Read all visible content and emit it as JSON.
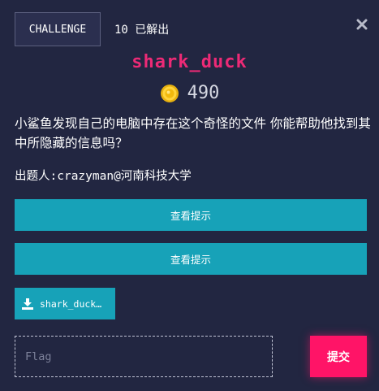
{
  "colors": {
    "background": "#222641",
    "challenge_name": "#ed2a76",
    "hint_button": "#17a2b8",
    "submit_button": "#ff1467"
  },
  "tabs": {
    "challenge": "CHALLENGE",
    "solves": "10 已解出"
  },
  "close_icon": "close-icon",
  "challenge": {
    "name": "shark_duck",
    "points": "490",
    "points_icon": "coin-icon",
    "description": "小鲨鱼发现自己的电脑中存在这个奇怪的文件 你能帮助他找到其中所隐藏的信息吗？",
    "author": "出题人:crazyman@河南科技大学"
  },
  "hints": [
    {
      "label": "查看提示"
    },
    {
      "label": "查看提示"
    }
  ],
  "files": [
    {
      "label": "shark_duck…",
      "icon": "download-icon"
    }
  ],
  "flag_input": {
    "placeholder": "Flag",
    "value": ""
  },
  "submit_label": "提交"
}
